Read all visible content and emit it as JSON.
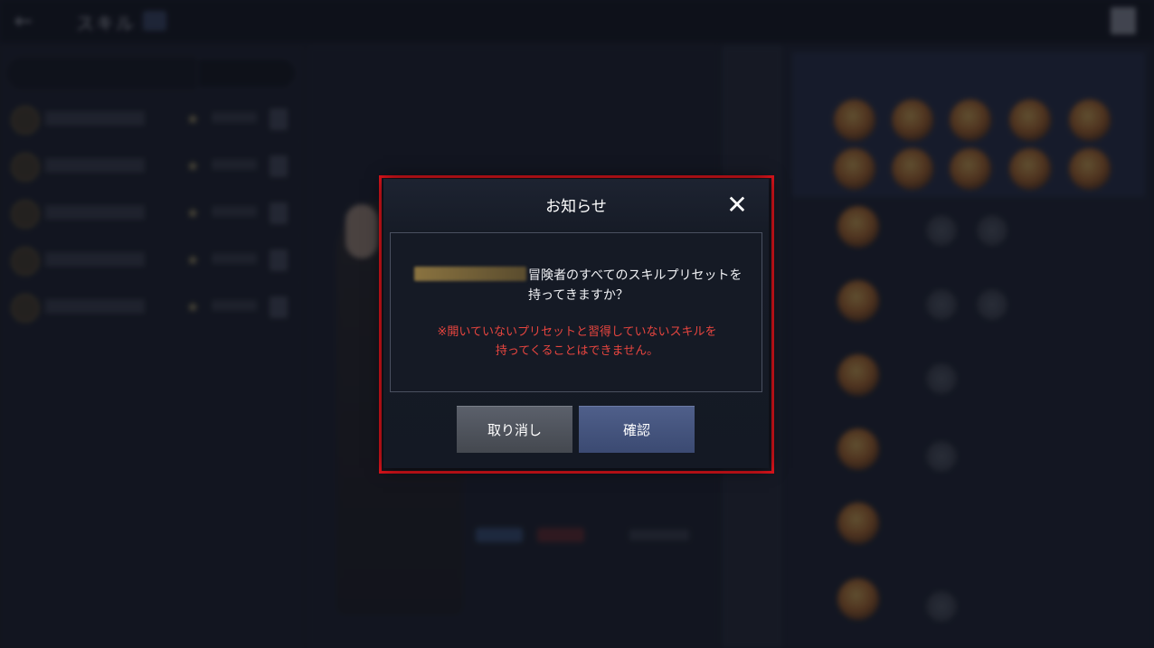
{
  "dialog": {
    "title": "お知らせ",
    "close_icon": "close-icon",
    "message_line1": "冒険者のすべてのスキルプリセットを",
    "message_line2": "持ってきますか？",
    "warning_line1": "※開いていないプリセットと習得していないスキルを",
    "warning_line2": "持ってくることはできません。",
    "cancel_label": "取り消し",
    "confirm_label": "確認",
    "warning_color": "#e7453f",
    "confirm_color": "#4f5f8a",
    "highlight_color": "#e3141c"
  },
  "background": {
    "back_icon": "back-arrow-icon",
    "exit_icon": "exit-icon",
    "blurred": true
  }
}
